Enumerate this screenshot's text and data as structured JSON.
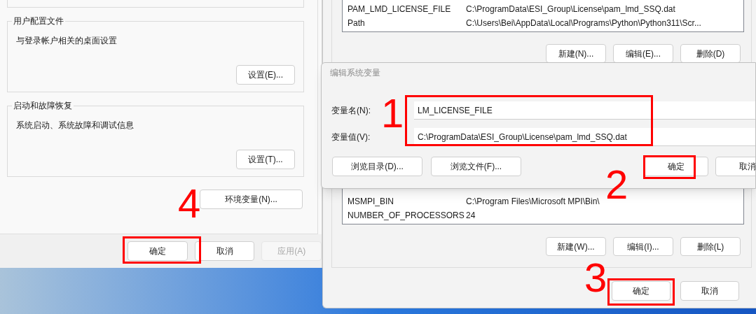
{
  "system_properties": {
    "groups": [
      {
        "title": "用户配置文件",
        "description": "与登录帐户相关的桌面设置",
        "button": "设置(E)..."
      },
      {
        "title": "启动和故障恢复",
        "description": "系统启动、系统故障和调试信息",
        "button": "设置(T)..."
      }
    ],
    "env_button": "环境变量(N)...",
    "buttons": [
      {
        "label": "确定",
        "disabled": false
      },
      {
        "label": "取消",
        "disabled": false
      },
      {
        "label": "应用(A)",
        "disabled": true
      }
    ]
  },
  "environment_variables": {
    "user_variables": [
      {
        "name": "PAM_LMD_LICENSE_FILE",
        "value": "C:\\ProgramData\\ESI_Group\\License\\pam_lmd_SSQ.dat"
      },
      {
        "name": "Path",
        "value": "C:\\Users\\Bei\\AppData\\Local\\Programs\\Python\\Python311\\Scr..."
      }
    ],
    "user_buttons": [
      "新建(N)...",
      "编辑(E)...",
      "删除(D)"
    ],
    "system_variables": [
      {
        "name": "MSMPI_BIN",
        "value": "C:\\Program Files\\Microsoft MPI\\Bin\\"
      },
      {
        "name": "NUMBER_OF_PROCESSORS",
        "value": "24"
      }
    ],
    "system_buttons": [
      "新建(W)...",
      "编辑(I)...",
      "删除(L)"
    ],
    "buttons": [
      "确定",
      "取消"
    ]
  },
  "edit_dialog": {
    "title": "编辑系统变量",
    "fields": [
      {
        "label": "变量名(N):",
        "value": "LM_LICENSE_FILE"
      },
      {
        "label": "变量值(V):",
        "value": "C:\\ProgramData\\ESI_Group\\License\\pam_lmd_SSQ.dat"
      }
    ],
    "browse_buttons": [
      "浏览目录(D)...",
      "浏览文件(F)..."
    ],
    "buttons": [
      "确定",
      "取消"
    ]
  },
  "annotations": [
    {
      "number": "1"
    },
    {
      "number": "2"
    },
    {
      "number": "3"
    },
    {
      "number": "4"
    }
  ]
}
